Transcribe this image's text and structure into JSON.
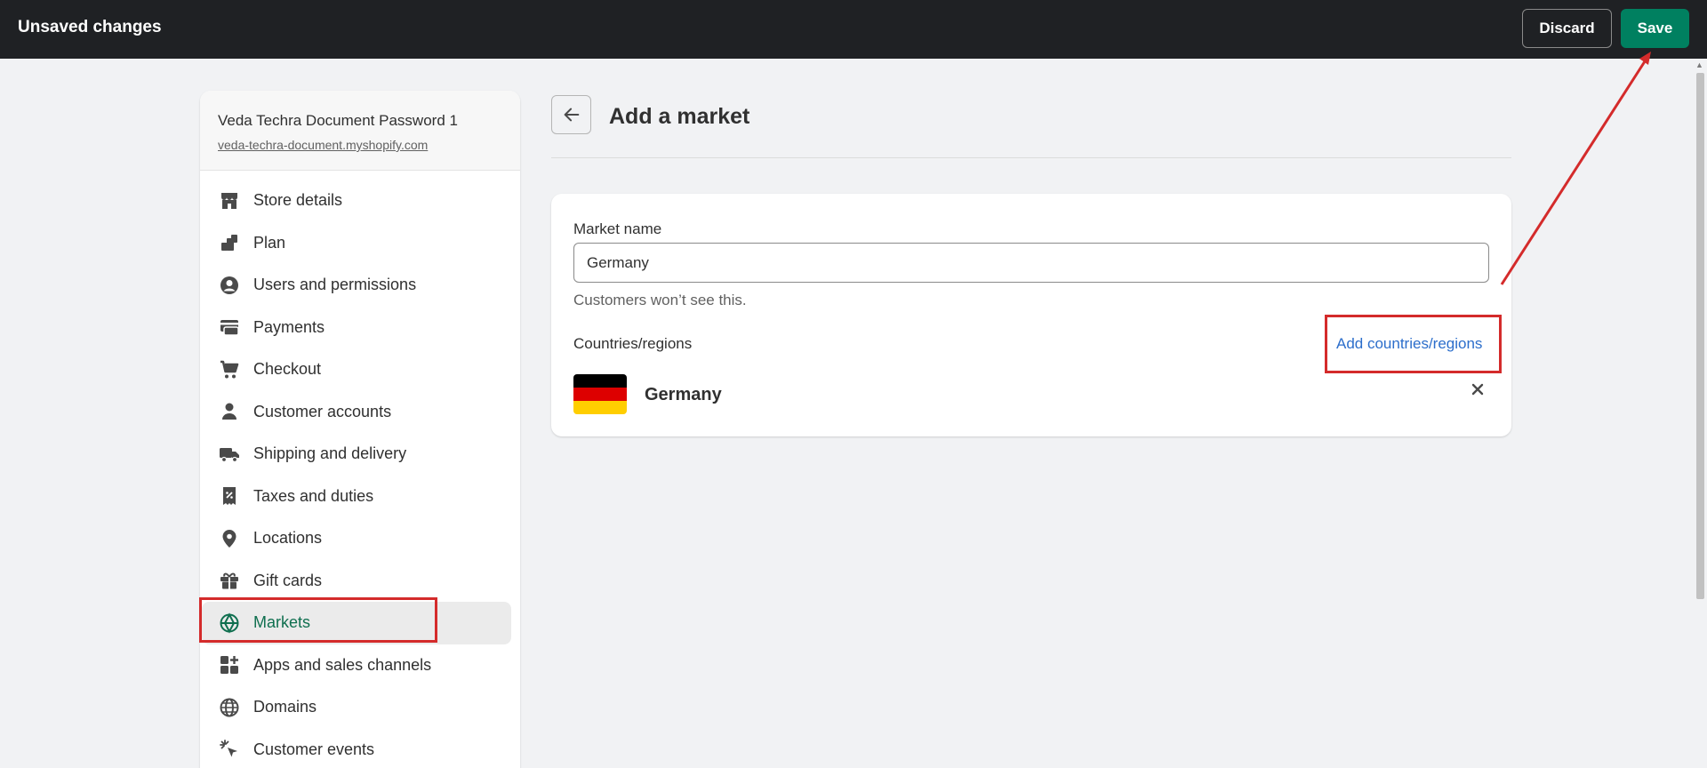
{
  "topbar": {
    "title": "Unsaved changes",
    "discard_label": "Discard",
    "save_label": "Save"
  },
  "store": {
    "name": "Veda Techra Document Password 1",
    "url": "veda-techra-document.myshopify.com"
  },
  "sidebar": {
    "items": [
      {
        "label": "Store details",
        "icon": "store-icon"
      },
      {
        "label": "Plan",
        "icon": "plan-icon"
      },
      {
        "label": "Users and permissions",
        "icon": "user-circle-icon"
      },
      {
        "label": "Payments",
        "icon": "payments-icon"
      },
      {
        "label": "Checkout",
        "icon": "cart-icon"
      },
      {
        "label": "Customer accounts",
        "icon": "person-icon"
      },
      {
        "label": "Shipping and delivery",
        "icon": "truck-icon"
      },
      {
        "label": "Taxes and duties",
        "icon": "receipt-icon"
      },
      {
        "label": "Locations",
        "icon": "location-pin-icon"
      },
      {
        "label": "Gift cards",
        "icon": "gift-icon"
      },
      {
        "label": "Markets",
        "icon": "globe-icon",
        "active": true
      },
      {
        "label": "Apps and sales channels",
        "icon": "apps-icon"
      },
      {
        "label": "Domains",
        "icon": "domains-globe-icon"
      },
      {
        "label": "Customer events",
        "icon": "cursor-click-icon"
      }
    ]
  },
  "main": {
    "title": "Add a market",
    "market_name_label": "Market name",
    "market_name_value": "Germany",
    "help_text": "Customers won’t see this.",
    "countries_label": "Countries/regions",
    "add_countries_label": "Add countries/regions",
    "countries": [
      {
        "name": "Germany",
        "flag_colors": [
          "#000000",
          "#dd0000",
          "#ffce00"
        ]
      }
    ]
  },
  "colors": {
    "topbar_bg": "#1f2124",
    "save_green": "#008060",
    "active_text": "#0f6f4f",
    "link_blue": "#2c6ecb",
    "annotation_red": "#d42b2b"
  }
}
